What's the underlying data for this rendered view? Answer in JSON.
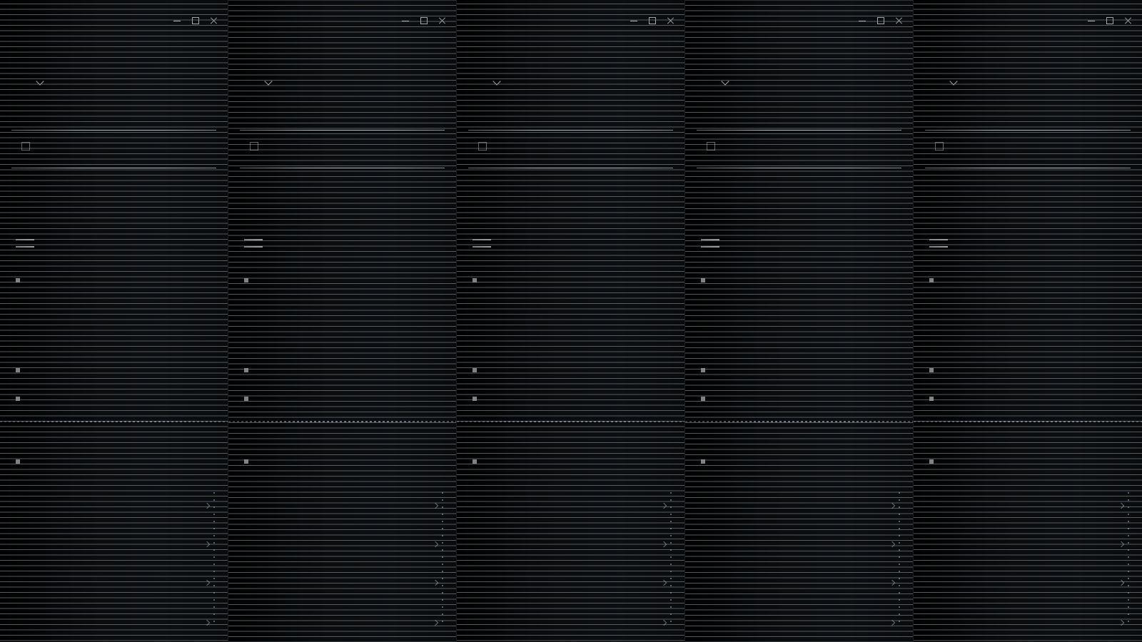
{
  "panels": [
    {
      "app_title": "",
      "heading": "",
      "card": {
        "title": "",
        "subtitle": "",
        "meta": ""
      },
      "link_a": "",
      "section_a": "",
      "link_b": "",
      "row_toggle": "",
      "link_c": "",
      "row_bullet": "",
      "link_d": "",
      "section_b": "",
      "row_main": "",
      "row_sub": "",
      "group_label": "",
      "group_row": "",
      "group_link": "",
      "items": [
        {
          "title": "",
          "sub": ""
        },
        {
          "title": "",
          "sub": ""
        },
        {
          "title": "",
          "sub": ""
        },
        {
          "title": "",
          "sub": ""
        }
      ]
    },
    {
      "app_title": "",
      "heading": "",
      "card": {
        "title": "",
        "subtitle": "",
        "meta": ""
      },
      "link_a": "",
      "section_a": "",
      "link_b": "",
      "row_toggle": "",
      "link_c": "",
      "row_bullet": "",
      "link_d": "",
      "section_b": "",
      "row_main": "",
      "row_sub": "",
      "group_label": "",
      "group_row": "",
      "group_link": "",
      "items": [
        {
          "title": "",
          "sub": ""
        },
        {
          "title": "",
          "sub": ""
        },
        {
          "title": "",
          "sub": ""
        },
        {
          "title": "",
          "sub": ""
        }
      ]
    },
    {
      "app_title": "",
      "heading": "",
      "card": {
        "title": "",
        "subtitle": "",
        "meta": ""
      },
      "link_a": "",
      "section_a": "",
      "link_b": "",
      "row_toggle": "",
      "link_c": "",
      "row_bullet": "",
      "link_d": "",
      "section_b": "",
      "row_main": "",
      "row_sub": "",
      "group_label": "",
      "group_row": "",
      "group_link": "",
      "items": [
        {
          "title": "",
          "sub": ""
        },
        {
          "title": "",
          "sub": ""
        },
        {
          "title": "",
          "sub": ""
        },
        {
          "title": "",
          "sub": ""
        }
      ]
    },
    {
      "app_title": "",
      "heading": "",
      "card": {
        "title": "",
        "subtitle": "",
        "meta": ""
      },
      "link_a": "",
      "section_a": "",
      "link_b": "",
      "row_toggle": "",
      "link_c": "",
      "row_bullet": "",
      "link_d": "",
      "section_b": "",
      "row_main": "",
      "row_sub": "",
      "group_label": "",
      "group_row": "",
      "group_link": "",
      "items": [
        {
          "title": "",
          "sub": ""
        },
        {
          "title": "",
          "sub": ""
        },
        {
          "title": "",
          "sub": ""
        },
        {
          "title": "",
          "sub": ""
        }
      ]
    },
    {
      "app_title": "",
      "heading": "",
      "card": {
        "title": "",
        "subtitle": "",
        "meta": ""
      },
      "link_a": "",
      "section_a": "",
      "link_b": "",
      "row_toggle": "",
      "link_c": "",
      "row_bullet": "",
      "link_d": "",
      "section_b": "",
      "row_main": "",
      "row_sub": "",
      "group_label": "",
      "group_row": "",
      "group_link": "",
      "items": [
        {
          "title": "",
          "sub": ""
        },
        {
          "title": "",
          "sub": ""
        },
        {
          "title": "",
          "sub": ""
        },
        {
          "title": "",
          "sub": ""
        }
      ]
    }
  ],
  "colors": {
    "background": "#030405",
    "scanline": "#969ca4",
    "text": "#dfe2e6",
    "link": "#4d6fa6"
  },
  "icons": [
    "minimize-icon",
    "maximize-icon",
    "close-icon",
    "pointer-icon",
    "toggle-icon",
    "bullet-icon",
    "chevron-right-icon"
  ]
}
